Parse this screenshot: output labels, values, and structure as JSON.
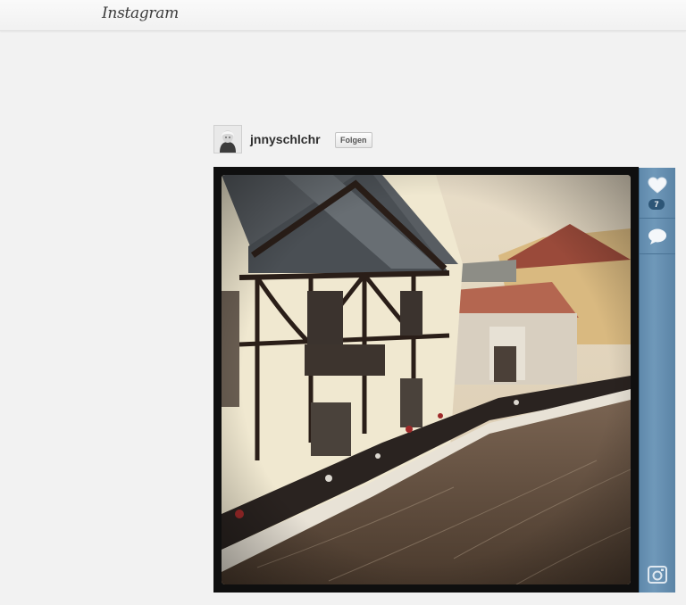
{
  "header": {
    "logo_text": "Instagram"
  },
  "post": {
    "username": "jnnyschlchr",
    "follow_label": "Folgen",
    "like_count": "7"
  },
  "icons": {
    "like": "heart-icon",
    "comment": "comment-bubble-icon",
    "camera": "instagram-camera-icon"
  },
  "colors": {
    "sidebar_blue": "#6a93b5",
    "count_badge": "#2d5677"
  }
}
